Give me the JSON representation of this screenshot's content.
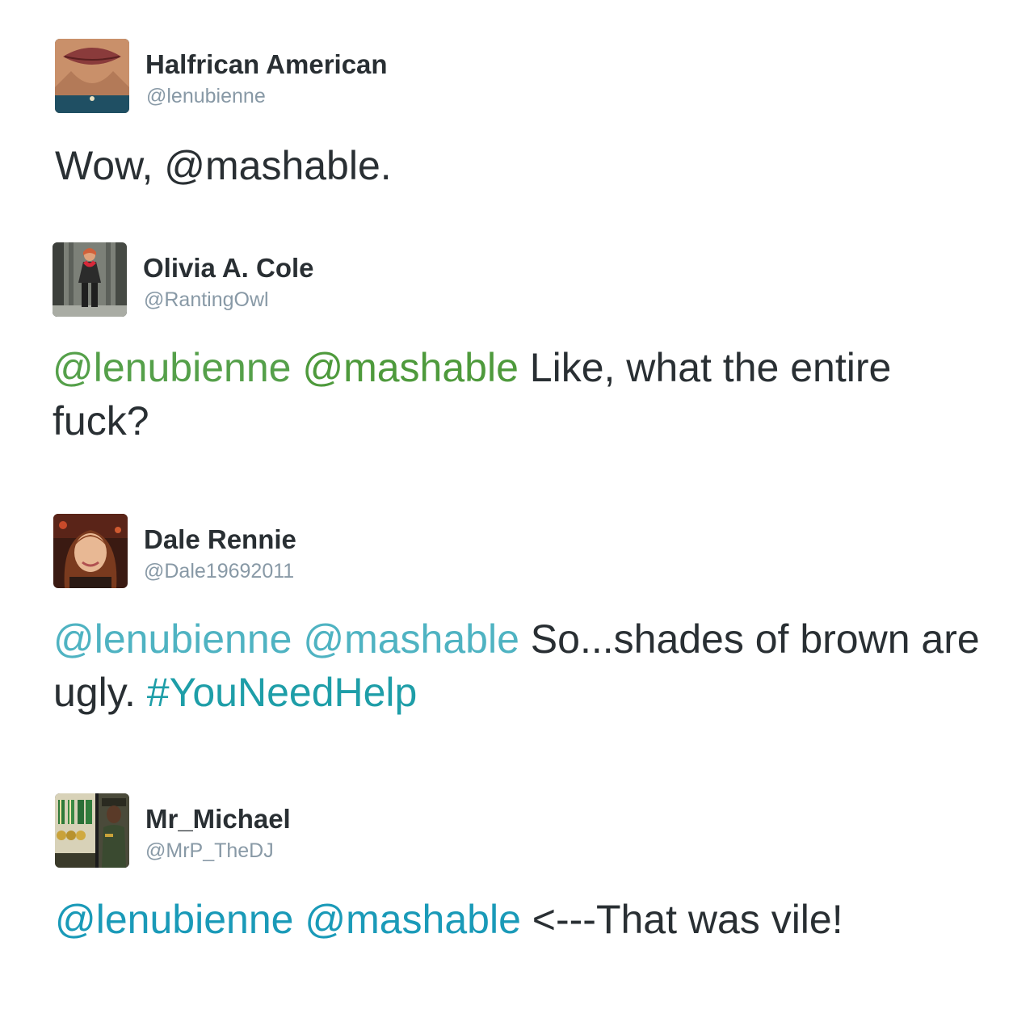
{
  "tweets": [
    {
      "display_name": "Halfrican American",
      "handle": "@lenubienne",
      "avatar_icon": "avatar-lips-photo",
      "text_parts": {
        "plain_before": "Wow, @mashable."
      }
    },
    {
      "display_name": "Olivia A. Cole",
      "handle": "@RantingOwl",
      "avatar_icon": "avatar-woman-standing-photo",
      "mention_1": "@lenubienne",
      "mention_2": "@mashable",
      "text": " Like, what the entire fuck?",
      "mention_color": "#4e9a3c"
    },
    {
      "display_name": "Dale Rennie",
      "handle": "@Dale19692011",
      "avatar_icon": "avatar-woman-portrait-photo",
      "mention_1": "@lenubienne",
      "mention_2": "@mashable",
      "text": " So...shades of brown are ugly. ",
      "hashtag": "#YouNeedHelp",
      "mention_color": "#4fb3c2",
      "hashtag_color": "#1e9ea8"
    },
    {
      "display_name": "Mr_Michael",
      "handle": "@MrP_TheDJ",
      "avatar_icon": "avatar-medals-soldier-photo",
      "mention_1": "@lenubienne",
      "mention_2": "@mashable",
      "text": " <---That was vile!",
      "mention_color": "#1a9ab8"
    }
  ]
}
